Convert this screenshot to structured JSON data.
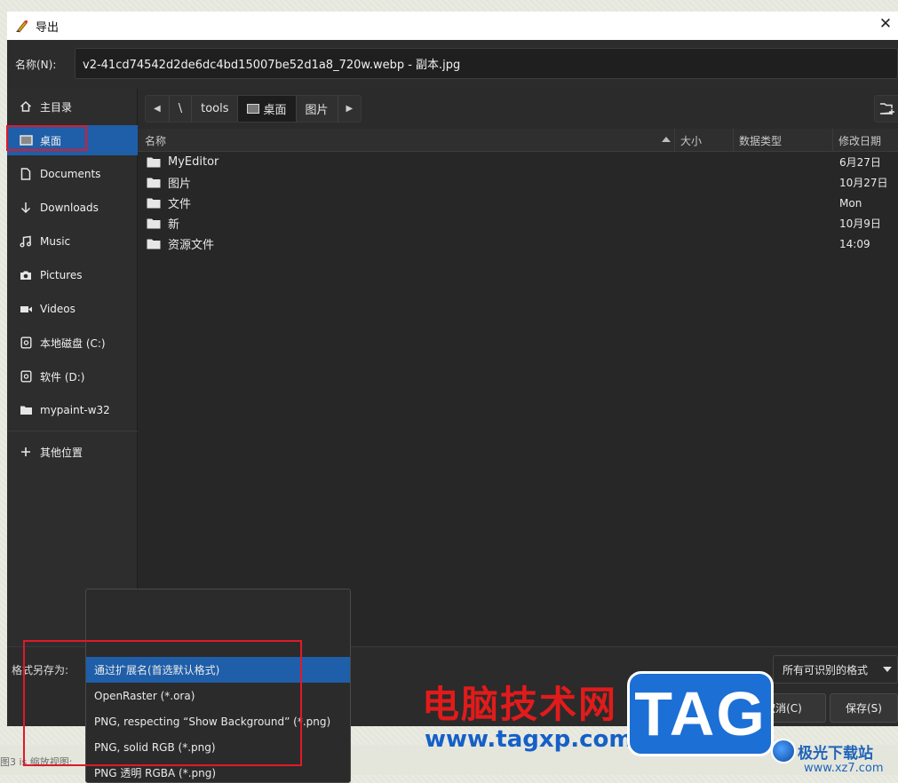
{
  "window": {
    "title": "导出"
  },
  "filename": {
    "label": "名称(N):",
    "value": "v2-41cd74542d2de6dc4bd15007be52d1a8_720w.webp - 副本.jpg"
  },
  "sidebar": {
    "items": [
      {
        "label": "主目录",
        "icon": "home-icon"
      },
      {
        "label": "桌面",
        "icon": "desktop-icon",
        "active": true
      },
      {
        "label": "Documents",
        "icon": "document-icon"
      },
      {
        "label": "Downloads",
        "icon": "download-icon"
      },
      {
        "label": "Music",
        "icon": "music-icon"
      },
      {
        "label": "Pictures",
        "icon": "camera-icon"
      },
      {
        "label": "Videos",
        "icon": "video-icon"
      },
      {
        "label": "本地磁盘 (C:)",
        "icon": "drive-icon"
      },
      {
        "label": "软件 (D:)",
        "icon": "drive-icon"
      },
      {
        "label": "mypaint-w32",
        "icon": "folder-icon"
      }
    ],
    "other_locations": "其他位置"
  },
  "path": {
    "crumbs": [
      "\\",
      "tools",
      "桌面",
      "图片"
    ],
    "current": "桌面"
  },
  "columns": {
    "name": "名称",
    "size": "大小",
    "type": "数据类型",
    "modified": "修改日期"
  },
  "files": [
    {
      "name": "MyEditor",
      "modified": "6月27日"
    },
    {
      "name": "图片",
      "modified": "10月27日"
    },
    {
      "name": "文件",
      "modified": "Mon"
    },
    {
      "name": "新",
      "modified": "10月9日"
    },
    {
      "name": "资源文件",
      "modified": "14:09"
    }
  ],
  "bottom": {
    "format_label": "格式另存为:",
    "filter_selected": "所有可识别的格式",
    "cancel_label": "取消(C)",
    "save_label": "保存(S)"
  },
  "format_options": [
    {
      "label": "通过扩展名(首选默认格式)",
      "selected": true
    },
    {
      "label": "OpenRaster (*.ora)"
    },
    {
      "label": "PNG, respecting “Show Background” (*.png)"
    },
    {
      "label": "PNG, solid RGB (*.png)"
    },
    {
      "label": "PNG 透明 RGBA (*.png)"
    }
  ],
  "status": {
    "text": "图3 is 缩放视图:"
  },
  "watermark": {
    "site_name": "电脑技术网",
    "site_url": "www.tagxp.com",
    "tag": "TAG",
    "partner_name": "极光下载站",
    "partner_url": "www.xz7.com"
  },
  "colors": {
    "accent": "#1f5ea8",
    "highlight_box": "#e0192a",
    "dialog_bg": "#2b2b2b"
  }
}
